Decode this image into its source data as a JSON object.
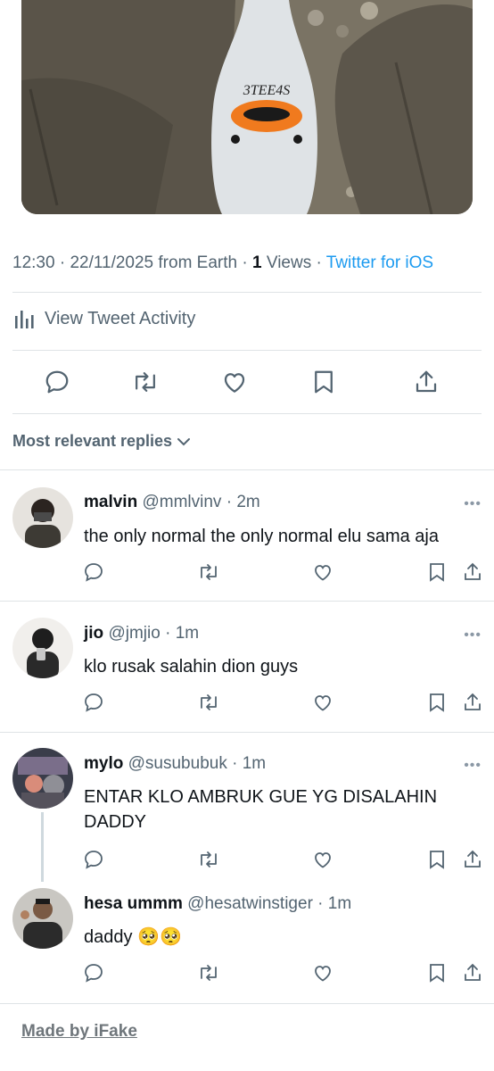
{
  "tweet": {
    "photo_caption": "3TEE4S",
    "time": "12:30",
    "date": "22/11/2025",
    "location": "from Earth",
    "views_count": "1",
    "views_label": "Views",
    "app": "Twitter for iOS",
    "activity_label": "View Tweet Activity"
  },
  "sort": {
    "label": "Most relevant replies"
  },
  "replies": [
    {
      "name": "malvin",
      "handle": "@mmlvinv",
      "time": "2m",
      "text": "the only normal the only normal elu sama aja",
      "more": "•••"
    },
    {
      "name": "jio",
      "handle": "@jmjio",
      "time": "1m",
      "text": "klo rusak salahin dion guys",
      "more": "•••"
    },
    {
      "name": "mylo",
      "handle": "@susububuk",
      "time": "1m",
      "text": "ENTAR KLO AMBRUK GUE YG DISALAHIN DADDY",
      "more": "•••"
    },
    {
      "name": "hesa ummm",
      "handle": "@hesatwinstiger",
      "time": "1m",
      "text": "daddy 🥺🥺",
      "more": "•••"
    }
  ],
  "footer": {
    "made_by": "Made by iFake"
  },
  "colors": {
    "accent": "#1d9bf0",
    "muted": "#536471",
    "text": "#0f1419",
    "divider": "#dfe3e6"
  },
  "icons": [
    "reply-icon",
    "retweet-icon",
    "like-icon",
    "bookmark-icon",
    "share-icon",
    "chart-icon",
    "chevron-down-icon"
  ]
}
